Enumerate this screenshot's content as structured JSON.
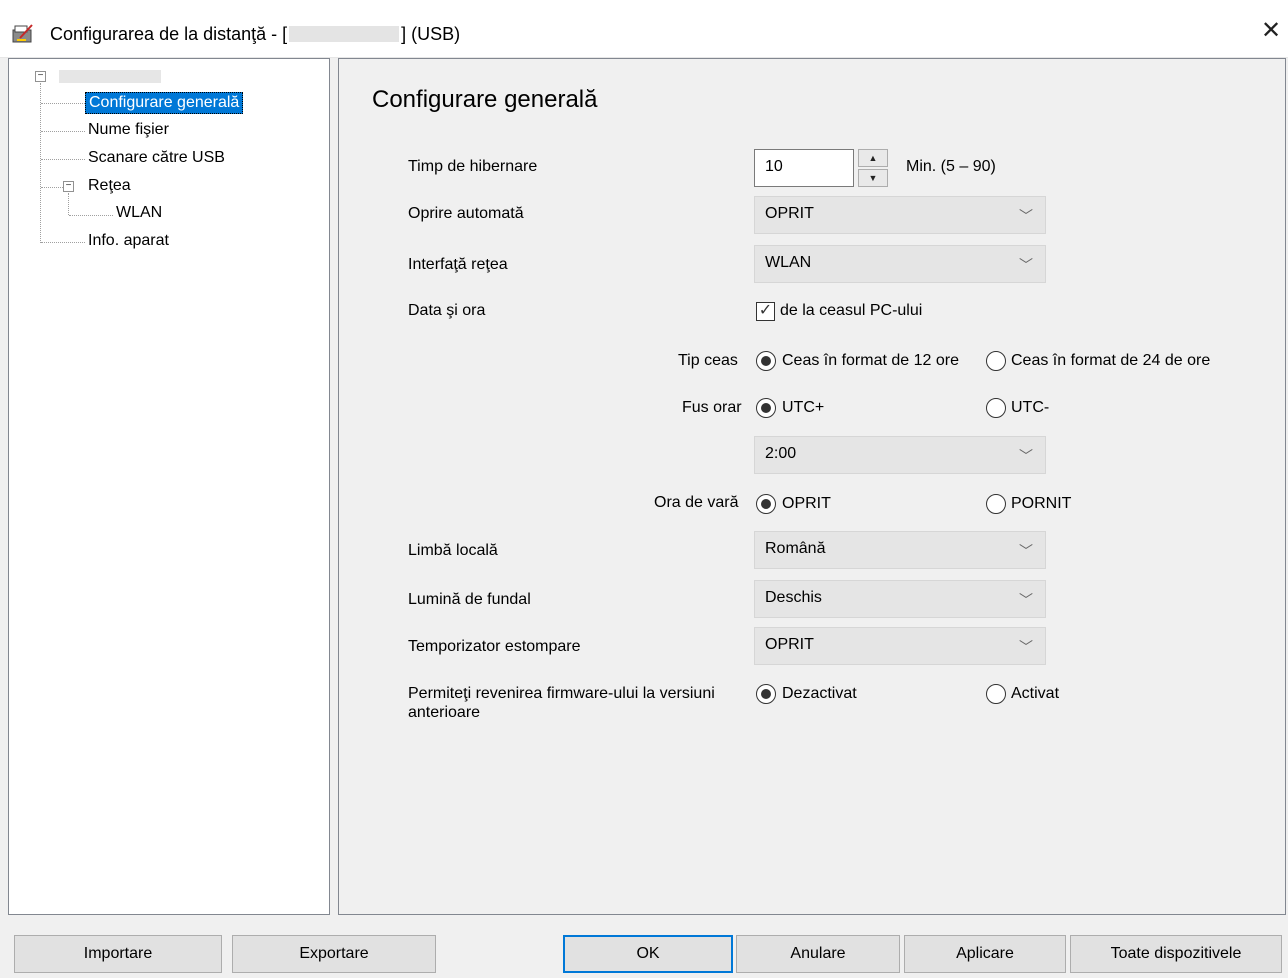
{
  "window": {
    "title_prefix": "Configurarea de la distanţă - [",
    "title_suffix": "] (USB)",
    "close_glyph": "✕"
  },
  "tree": {
    "items": [
      {
        "label": "Configurare generală",
        "selected": true
      },
      {
        "label": "Nume fişier"
      },
      {
        "label": "Scanare către USB"
      },
      {
        "label": "Reţea"
      },
      {
        "label": "WLAN"
      },
      {
        "label": "Info. aparat"
      }
    ]
  },
  "main": {
    "title": "Configurare generală",
    "sleep": {
      "label": "Timp de hibernare",
      "value": "10",
      "range": "Min. (5 – 90)"
    },
    "auto_off": {
      "label": "Oprire automată",
      "value": "OPRIT"
    },
    "net_interface": {
      "label": "Interfaţă reţea",
      "value": "WLAN"
    },
    "date_time": {
      "label": "Data şi ora",
      "checkbox_label": "de la ceasul PC-ului",
      "checked": true
    },
    "clock_type": {
      "label": "Tip ceas",
      "opt12": "Ceas în format de 12 ore",
      "opt24": "Ceas în format de 24 de ore",
      "selected": "12"
    },
    "timezone": {
      "label": "Fus orar",
      "opt_plus": "UTC+",
      "opt_minus": "UTC-",
      "selected": "UTC+",
      "offset": "2:00"
    },
    "dst": {
      "label": "Ora de vară",
      "opt_off": "OPRIT",
      "opt_on": "PORNIT",
      "selected": "OPRIT"
    },
    "language": {
      "label": "Limbă locală",
      "value": "Română"
    },
    "backlight": {
      "label": "Lumină de fundal",
      "value": "Deschis"
    },
    "dim_timer": {
      "label": "Temporizator estompare",
      "value": "OPRIT"
    },
    "firmware": {
      "label": "Permiteţi revenirea firmware-ului la versiuni anterioare",
      "opt_off": "Dezactivat",
      "opt_on": "Activat",
      "selected": "Dezactivat"
    }
  },
  "buttons": {
    "import": "Importare",
    "export": "Exportare",
    "ok": "OK",
    "cancel": "Anulare",
    "apply": "Aplicare",
    "all_devices": "Toate dispozitivele"
  }
}
